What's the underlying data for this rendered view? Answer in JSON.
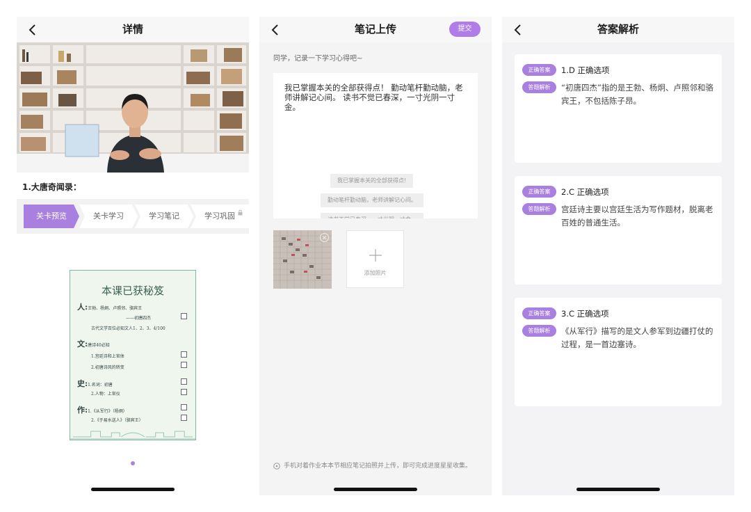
{
  "detail": {
    "title": "详情",
    "course_title": "1.大唐奇闻录：",
    "steps": [
      {
        "label": "关卡预览",
        "active": true
      },
      {
        "label": "关卡学习",
        "active": false
      },
      {
        "label": "学习笔记",
        "active": false
      },
      {
        "label": "学习巩固",
        "active": false
      }
    ],
    "card": {
      "title": "本课已获秘笈",
      "rows": [
        {
          "big": "人:",
          "text": "王勃、杨炯、卢照邻、骆宾王"
        },
        {
          "big": "",
          "text": "——初唐四杰"
        },
        {
          "big": "",
          "text": "古代文学百位必知文人1、2、3、4/100"
        },
        {
          "big": "文:",
          "text": "唐诗40必知"
        },
        {
          "big": "",
          "text": "1.宫廷诗和上官体"
        },
        {
          "big": "",
          "text": "2.初唐诗风的转变"
        },
        {
          "big": "史:",
          "text": "1.名词：初唐"
        },
        {
          "big": "",
          "text": "2.人物：上官仪"
        },
        {
          "big": "作:",
          "text": "1.《从军行》（杨炯）"
        },
        {
          "big": "",
          "text": "2.《于易水送人》（骆宾王）"
        }
      ]
    }
  },
  "notes": {
    "title": "笔记上传",
    "submit_label": "提交",
    "prompt": "同学，记录一下学习心得吧~",
    "note_text": "我已掌握本关的全部获得点！ 勤动笔杆勤动脑，老师讲解记心间。 读书不觉已春深，一寸光阴一寸金。",
    "suggestions": [
      "我已掌握本关的全部获得点!",
      "勤动笔杆勤动脑，老师讲解记心间。",
      "读书不觉已春深，一寸光阴一寸金。"
    ],
    "add_photo_label": "添加照片",
    "tip": "手机对着作业本本节相应笔记拍照并上传，即可完成进度星星收集。"
  },
  "answers": {
    "title": "答案解析",
    "badge_answer": "正确答案",
    "badge_explain": "答题解析",
    "items": [
      {
        "answer": "1.D 正确选项",
        "explanation": "“初唐四杰”指的是王勃、杨炯、卢照邻和骆宾王，不包括陈子昂。"
      },
      {
        "answer": "2.C 正确选项",
        "explanation": "宫廷诗主要以宫廷生活为写作题材，脱离老百姓的普通生活。"
      },
      {
        "answer": "3.C 正确选项",
        "explanation": "《从军行》描写的是文人参军到边疆打仗的过程，是一首边塞诗。"
      }
    ]
  },
  "colors": {
    "accent": "#a980df",
    "accent_light": "#d6c4f3",
    "card_border": "#7fb7a5"
  }
}
